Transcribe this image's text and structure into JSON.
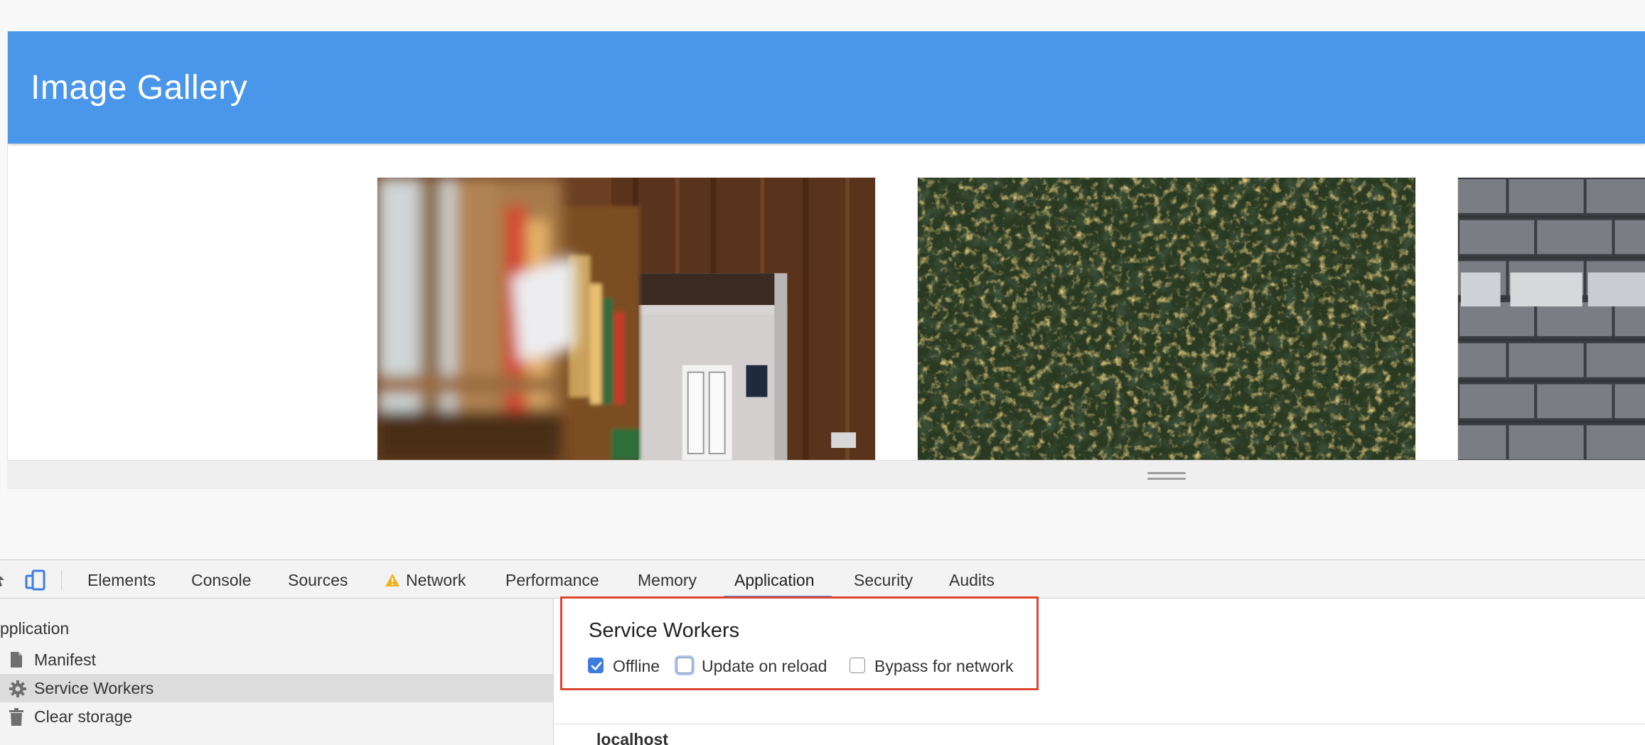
{
  "page": {
    "app_title": "Image Gallery"
  },
  "devtools": {
    "tabs": [
      {
        "label": "Elements"
      },
      {
        "label": "Console"
      },
      {
        "label": "Sources"
      },
      {
        "label": "Network",
        "warning": true
      },
      {
        "label": "Performance"
      },
      {
        "label": "Memory"
      },
      {
        "label": "Application",
        "active": true
      },
      {
        "label": "Security"
      },
      {
        "label": "Audits"
      }
    ],
    "sidebar": {
      "heading": "pplication",
      "items": [
        {
          "label": "Manifest",
          "icon": "document-icon"
        },
        {
          "label": "Service Workers",
          "icon": "gear-icon",
          "selected": true
        },
        {
          "label": "Clear storage",
          "icon": "trash-icon"
        }
      ]
    },
    "service_workers": {
      "title": "Service Workers",
      "options": [
        {
          "label": "Offline",
          "checked": true
        },
        {
          "label": "Update on reload",
          "checked": false,
          "focused": true
        },
        {
          "label": "Bypass for network",
          "checked": false
        }
      ],
      "origin": "localhost"
    }
  },
  "colors": {
    "header_blue": "#4a96ea",
    "highlight_red": "#e0452f",
    "checkbox_blue": "#3e7de0",
    "tab_underline": "#4a8af4"
  }
}
